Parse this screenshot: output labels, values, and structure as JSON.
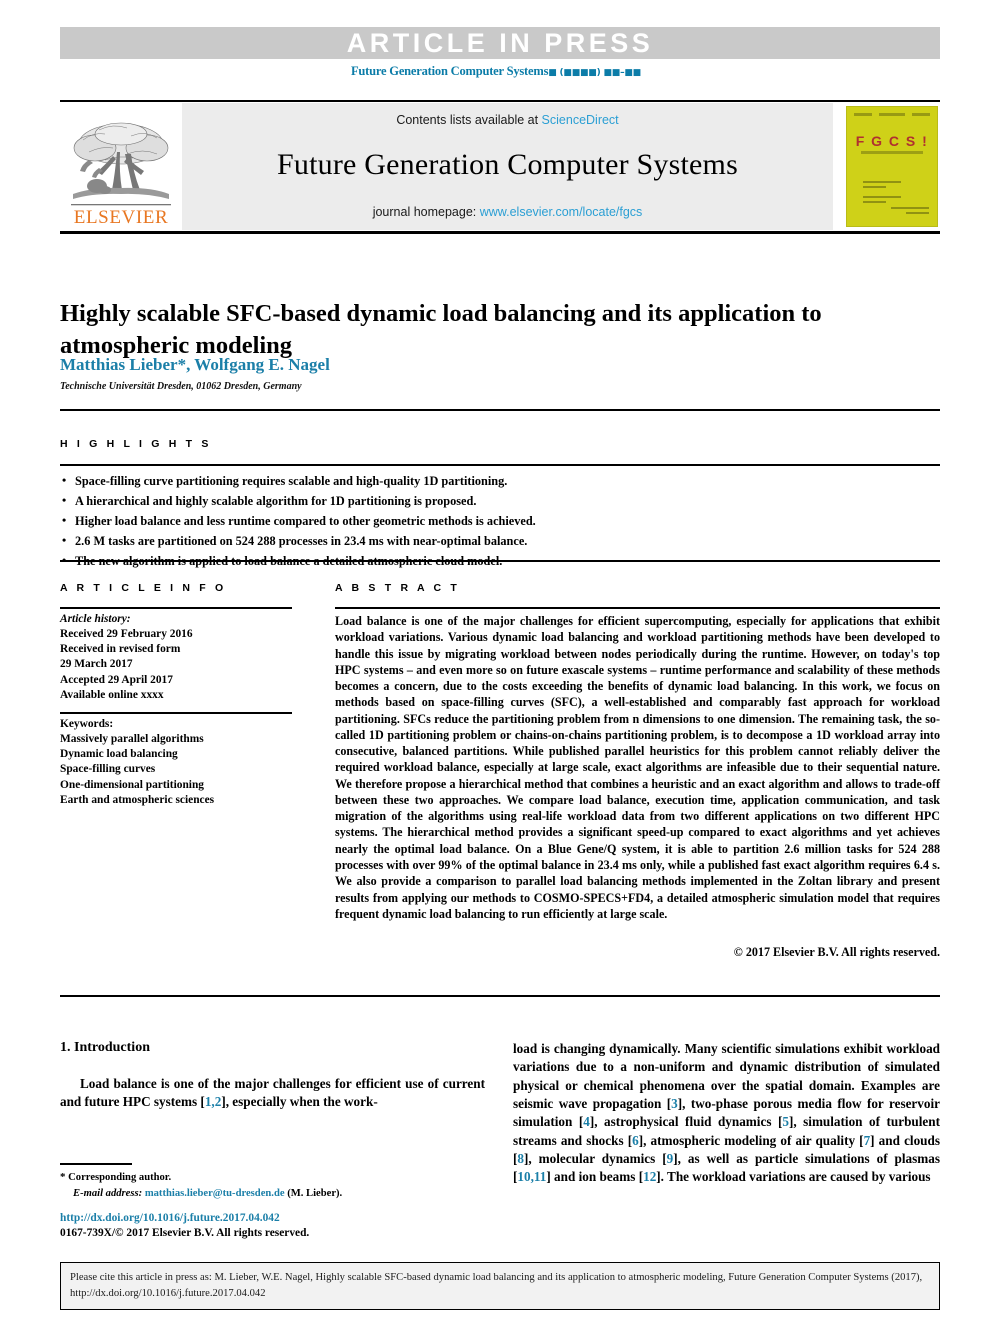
{
  "banner": {
    "article_in_press": "ARTICLE  IN  PRESS",
    "journal_reference_prefix": "Future Generation Computer Systems",
    "journal_reference_placeholders": "■ (■■■■) ■■–■■"
  },
  "masthead": {
    "contents_prefix": "Contents lists available at ",
    "contents_link": "ScienceDirect",
    "journal_name": "Future Generation Computer Systems",
    "homepage_prefix": "journal homepage: ",
    "homepage_link": "www.elsevier.com/locate/fgcs",
    "publisher_logo_text": "ELSEVIER",
    "cover_logo_text": "F G C S !"
  },
  "article": {
    "title": "Highly scalable SFC-based dynamic load balancing and its application to atmospheric modeling",
    "authors": "Matthias Lieber*, Wolfgang E. Nagel",
    "affiliation": "Technische Universität Dresden, 01062 Dresden, Germany"
  },
  "highlights": {
    "heading": "H I G H L I G H T S",
    "items": [
      "Space-filling curve partitioning requires scalable and high-quality 1D partitioning.",
      "A hierarchical and highly scalable algorithm for 1D partitioning is proposed.",
      "Higher load balance and less runtime compared to other geometric methods is achieved.",
      "2.6 M tasks are partitioned on 524 288 processes in 23.4 ms with near-optimal balance.",
      "The new algorithm is applied to load balance a detailed atmospheric cloud model."
    ]
  },
  "article_info": {
    "heading": "A R T I C L E    I N F O",
    "history_label": "Article history:",
    "history_lines": [
      "Received 29 February 2016",
      "Received in revised form",
      "29 March 2017",
      "Accepted 29 April 2017",
      "Available online xxxx"
    ],
    "keywords_label": "Keywords:",
    "keywords": [
      "Massively parallel algorithms",
      "Dynamic load balancing",
      "Space-filling curves",
      "One-dimensional partitioning",
      "Earth and atmospheric sciences"
    ]
  },
  "abstract": {
    "heading": "A B S T R A C T",
    "text": "Load balance is one of the major challenges for efficient supercomputing, especially for applications that exhibit workload variations. Various dynamic load balancing and workload partitioning methods have been developed to handle this issue by migrating workload between nodes periodically during the runtime. However, on today's top HPC systems – and even more so on future exascale systems – runtime performance and scalability of these methods becomes a concern, due to the costs exceeding the benefits of dynamic load balancing. In this work, we focus on methods based on space-filling curves (SFC), a well-established and comparably fast approach for workload partitioning. SFCs reduce the partitioning problem from n dimensions to one dimension. The remaining task, the so-called 1D partitioning problem or chains-on-chains partitioning problem, is to decompose a 1D workload array into consecutive, balanced partitions. While published parallel heuristics for this problem cannot reliably deliver the required workload balance, especially at large scale, exact algorithms are infeasible due to their sequential nature. We therefore propose a hierarchical method that combines a heuristic and an exact algorithm and allows to trade-off between these two approaches. We compare load balance, execution time, application communication, and task migration of the algorithms using real-life workload data from two different applications on two different HPC systems. The hierarchical method provides a significant speed-up compared to exact algorithms and yet achieves nearly the optimal load balance. On a Blue Gene/Q system, it is able to partition 2.6 million tasks for 524 288 processes with over 99% of the optimal balance in 23.4 ms only, while a published fast exact algorithm requires 6.4 s. We also provide a comparison to parallel load balancing methods implemented in the Zoltan library and present results from applying our methods to COSMO-SPECS+FD4, a detailed atmospheric simulation model that requires frequent dynamic load balancing to run efficiently at large scale.",
    "copyright": "© 2017 Elsevier B.V. All rights reserved."
  },
  "body": {
    "section_title": "1. Introduction",
    "left_paragraph_pre": "Load balance is one of the major challenges for efficient use of current and future HPC systems [",
    "left_ref_1": "1,2",
    "left_paragraph_post": "], especially when the work-",
    "right_parts": [
      {
        "t": "load is changing dynamically. Many scientific simulations exhibit workload variations due to a non-uniform and dynamic distribution of simulated physical or chemical phenomena over the spatial domain. Examples are seismic wave propagation [",
        "r": null
      },
      {
        "t": "",
        "r": "3"
      },
      {
        "t": "], two-phase porous media flow for reservoir simulation [",
        "r": null
      },
      {
        "t": "",
        "r": "4"
      },
      {
        "t": "], astrophysical fluid dynamics [",
        "r": null
      },
      {
        "t": "",
        "r": "5"
      },
      {
        "t": "], simulation of turbulent streams and shocks [",
        "r": null
      },
      {
        "t": "",
        "r": "6"
      },
      {
        "t": "], atmospheric modeling of air quality [",
        "r": null
      },
      {
        "t": "",
        "r": "7"
      },
      {
        "t": "] and clouds [",
        "r": null
      },
      {
        "t": "",
        "r": "8"
      },
      {
        "t": "], molecular dynamics [",
        "r": null
      },
      {
        "t": "",
        "r": "9"
      },
      {
        "t": "], as well as particle simulations of plasmas [",
        "r": null
      },
      {
        "t": "",
        "r": "10,11"
      },
      {
        "t": "] and ion beams [",
        "r": null
      },
      {
        "t": "",
        "r": "12"
      },
      {
        "t": "]. The workload variations are caused by various",
        "r": null
      }
    ]
  },
  "footnote": {
    "corresponding_author": "Corresponding author.",
    "email_label": "E-mail address:",
    "email": "matthias.lieber@tu-dresden.de",
    "email_suffix": "(M. Lieber).",
    "doi_url": "http://dx.doi.org/10.1016/j.future.2017.04.042",
    "issn_line": "0167-739X/© 2017 Elsevier B.V. All rights reserved."
  },
  "cite_box": {
    "text": "Please cite this article in press as: M. Lieber, W.E. Nagel, Highly scalable SFC-based dynamic load balancing and its application to atmospheric modeling, Future Generation Computer Systems (2017), http://dx.doi.org/10.1016/j.future.2017.04.042"
  },
  "colors": {
    "link": "#1b7fa8",
    "banner_bg": "#c9c9c9",
    "masthead_bg": "#ececec",
    "elsevier_orange": "#E87722",
    "cover_yellow": "#cfd118"
  }
}
